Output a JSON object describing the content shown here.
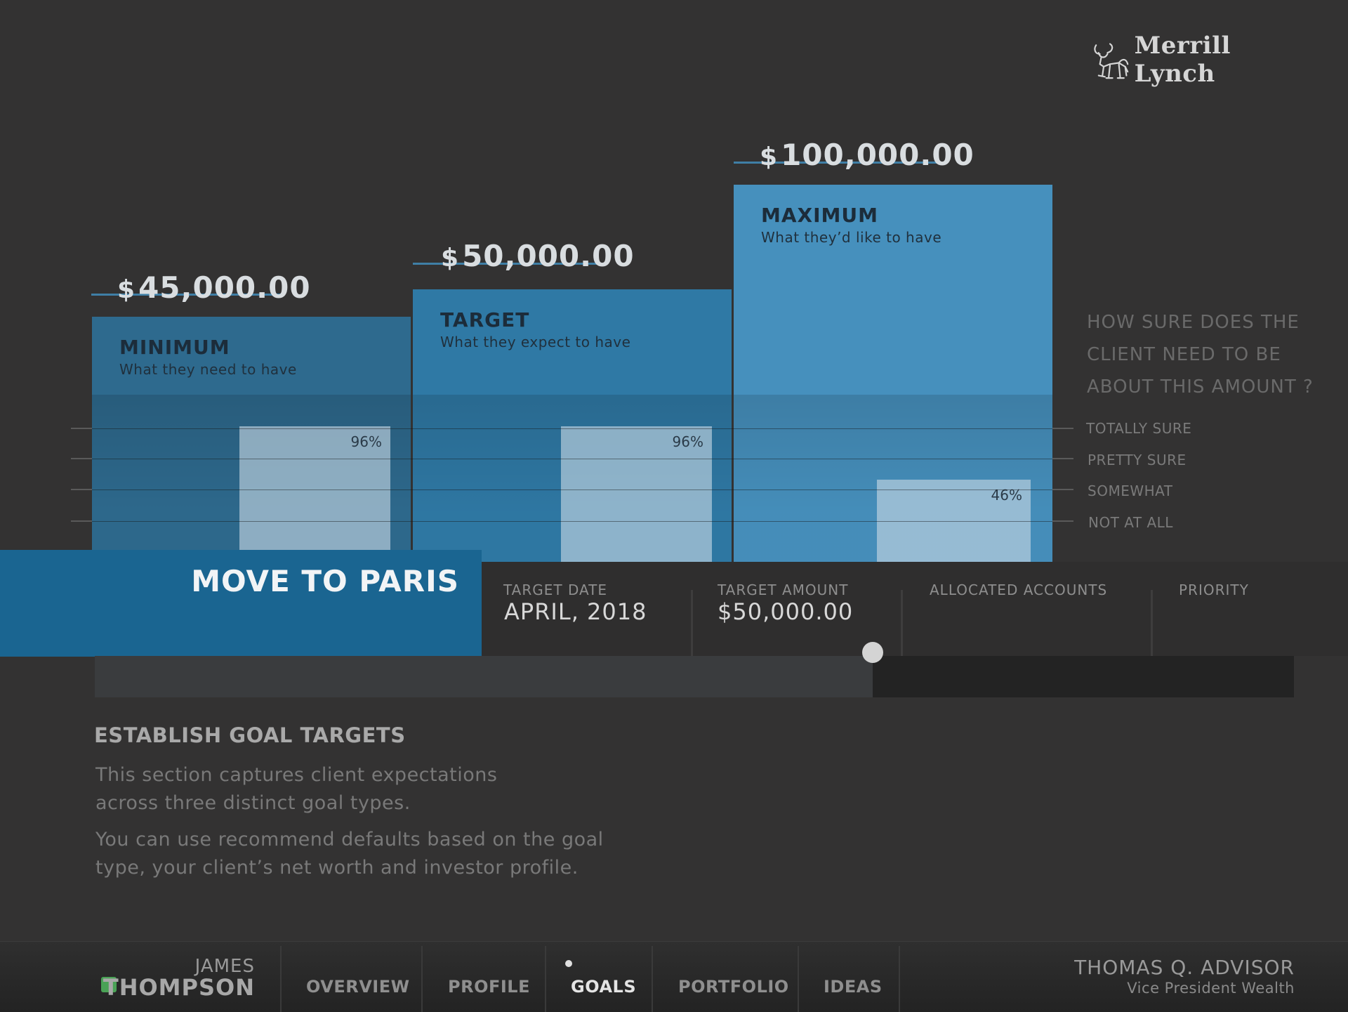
{
  "brand": {
    "name": "Merrill Lynch",
    "logo_icon": "bull-icon"
  },
  "tiers": [
    {
      "name": "MINIMUM",
      "description": "What they need to have",
      "currency": "$",
      "amount": "45,000.00",
      "confidence_label": "96%",
      "confidence": 0.96,
      "color": "#2e6a8e"
    },
    {
      "name": "TARGET",
      "description": "What they expect to have",
      "currency": "$",
      "amount": "50,000.00",
      "confidence_label": "96%",
      "confidence": 0.96,
      "color": "#2f79a5"
    },
    {
      "name": "MAXIMUM",
      "description": "What they’d like to have",
      "currency": "$",
      "amount": "100,000.00",
      "confidence_label": "46%",
      "confidence": 0.46,
      "color": "#4690bd"
    }
  ],
  "certainty": {
    "question": "HOW SURE DOES THE CLIENT NEED TO BE ABOUT THIS AMOUNT ?",
    "levels": [
      "TOTALLY SURE",
      "PRETTY SURE",
      "SOMEWHAT",
      "NOT AT ALL"
    ]
  },
  "goal": {
    "title": "MOVE TO PARIS",
    "fields": [
      {
        "label": "TARGET DATE",
        "value": "APRIL, 2018",
        "currency": ""
      },
      {
        "label": "TARGET AMOUNT",
        "value": "50,000.00",
        "currency": "$"
      },
      {
        "label": "ALLOCATED ACCOUNTS",
        "value": "",
        "currency": ""
      },
      {
        "label": "PRIORITY",
        "value": "",
        "currency": ""
      }
    ],
    "slider_progress": 0.649
  },
  "description": {
    "title": "ESTABLISH GOAL TARGETS",
    "paragraph1": "This section captures client expectations across three distinct goal types.",
    "paragraph2": "You can use recommend defaults based on the goal type, your client’s net worth and investor profile."
  },
  "nav": {
    "client_first": "JAMES",
    "client_last": "THOMPSON",
    "client_status_color": "#4aa256",
    "tabs": [
      "OVERVIEW",
      "PROFILE",
      "GOALS",
      "PORTFOLIO",
      "IDEAS"
    ],
    "active_tab": "GOALS",
    "advisor_name": "THOMAS Q. ADVISOR",
    "advisor_role": "Vice President Wealth"
  }
}
